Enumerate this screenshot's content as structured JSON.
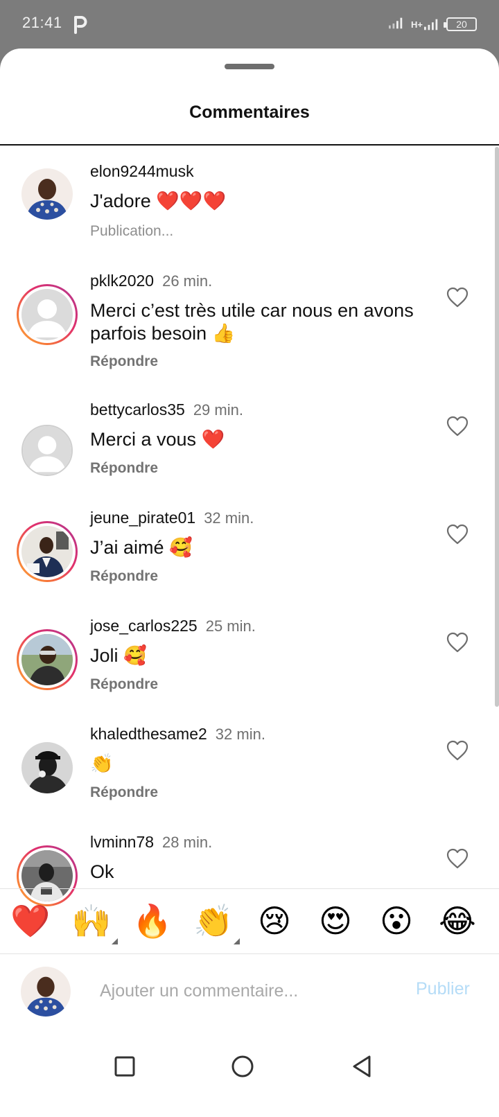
{
  "status_bar": {
    "time": "21:41",
    "app_icon": "parking-icon",
    "network_label": "H+",
    "battery": "20"
  },
  "sheet": {
    "title": "Commentaires"
  },
  "comments": [
    {
      "username": "elon9244musk",
      "time": "",
      "text": "J'adore ❤️❤️❤️",
      "action": "Publication...",
      "avatar": "photo",
      "story_ring": false,
      "like_icon": false
    },
    {
      "username": "pklk2020",
      "time": "26 min.",
      "text": "Merci c’est très utile car nous en avons parfois besoin 👍",
      "action": "Répondre",
      "avatar": "placeholder",
      "story_ring": true,
      "like_icon": true
    },
    {
      "username": "bettycarlos35",
      "time": "29 min.",
      "text": "Merci a vous ❤️",
      "action": "Répondre",
      "avatar": "placeholder",
      "story_ring": false,
      "like_icon": true
    },
    {
      "username": "jeune_pirate01",
      "time": "32 min.",
      "text": "J’ai aimé 🥰",
      "action": "Répondre",
      "avatar": "photo",
      "story_ring": true,
      "like_icon": true
    },
    {
      "username": "jose_carlos225",
      "time": "25 min.",
      "text": "Joli 🥰",
      "action": "Répondre",
      "avatar": "photo",
      "story_ring": true,
      "like_icon": true
    },
    {
      "username": "khaledthesame2",
      "time": "32 min.",
      "text": "👏",
      "action": "Répondre",
      "avatar": "photo",
      "story_ring": false,
      "like_icon": true
    },
    {
      "username": "lvminn78",
      "time": "28 min.",
      "text": "Ok",
      "action": "",
      "avatar": "photo",
      "story_ring": true,
      "like_icon": true
    }
  ],
  "quick_emojis": [
    "❤️",
    "🙌",
    "🔥",
    "👏",
    "😢",
    "😍",
    "😮",
    "😂"
  ],
  "composer": {
    "placeholder": "Ajouter un commentaire...",
    "publish_label": "Publier"
  },
  "colors": {
    "publish_disabled": "#b5dcf7",
    "story_ring_start": "#fcaf45",
    "story_ring_end": "#c13584",
    "muted_text": "#737373"
  }
}
